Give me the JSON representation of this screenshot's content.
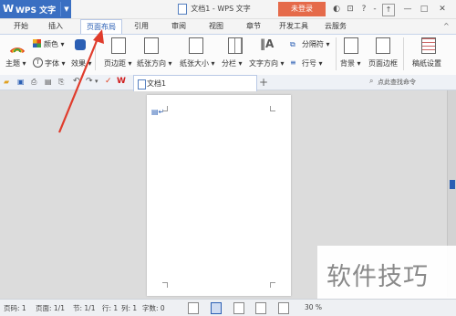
{
  "app": {
    "name": "WPS 文字",
    "logo": "W"
  },
  "window": {
    "title": "文档1 - WPS 文字",
    "login_label": "未登录"
  },
  "menu_tabs": [
    "开始",
    "插入",
    "页面布局",
    "引用",
    "审阅",
    "视图",
    "章节",
    "开发工具",
    "云服务"
  ],
  "active_tab": "页面布局",
  "ribbon": {
    "theme": "主题",
    "colors": "颜色",
    "fonts": "字体",
    "effects": "效果",
    "margins": "页边距",
    "orientation": "纸张方向",
    "size": "纸张大小",
    "columns": "分栏",
    "text_direction": "文字方向",
    "breaks": "分隔符",
    "line_numbers": "行号",
    "background": "背景",
    "borders": "页面边框",
    "manuscript": "稿纸设置"
  },
  "doc_tab": {
    "label": "文档1",
    "add": "+"
  },
  "search_label": "点此查找命令",
  "status": {
    "page": "页码: 1",
    "pages": "页面: 1/1",
    "section": "节: 1/1",
    "row": "行: 1",
    "col": "列: 1",
    "words": "字数: 0",
    "zoom": "30 %"
  },
  "watermark": "软件技巧",
  "colors": {
    "accent": "#2b5fb4",
    "app_button": "#3a6fc2",
    "login": "#e56a4a",
    "arrow": "#e03c2c"
  }
}
